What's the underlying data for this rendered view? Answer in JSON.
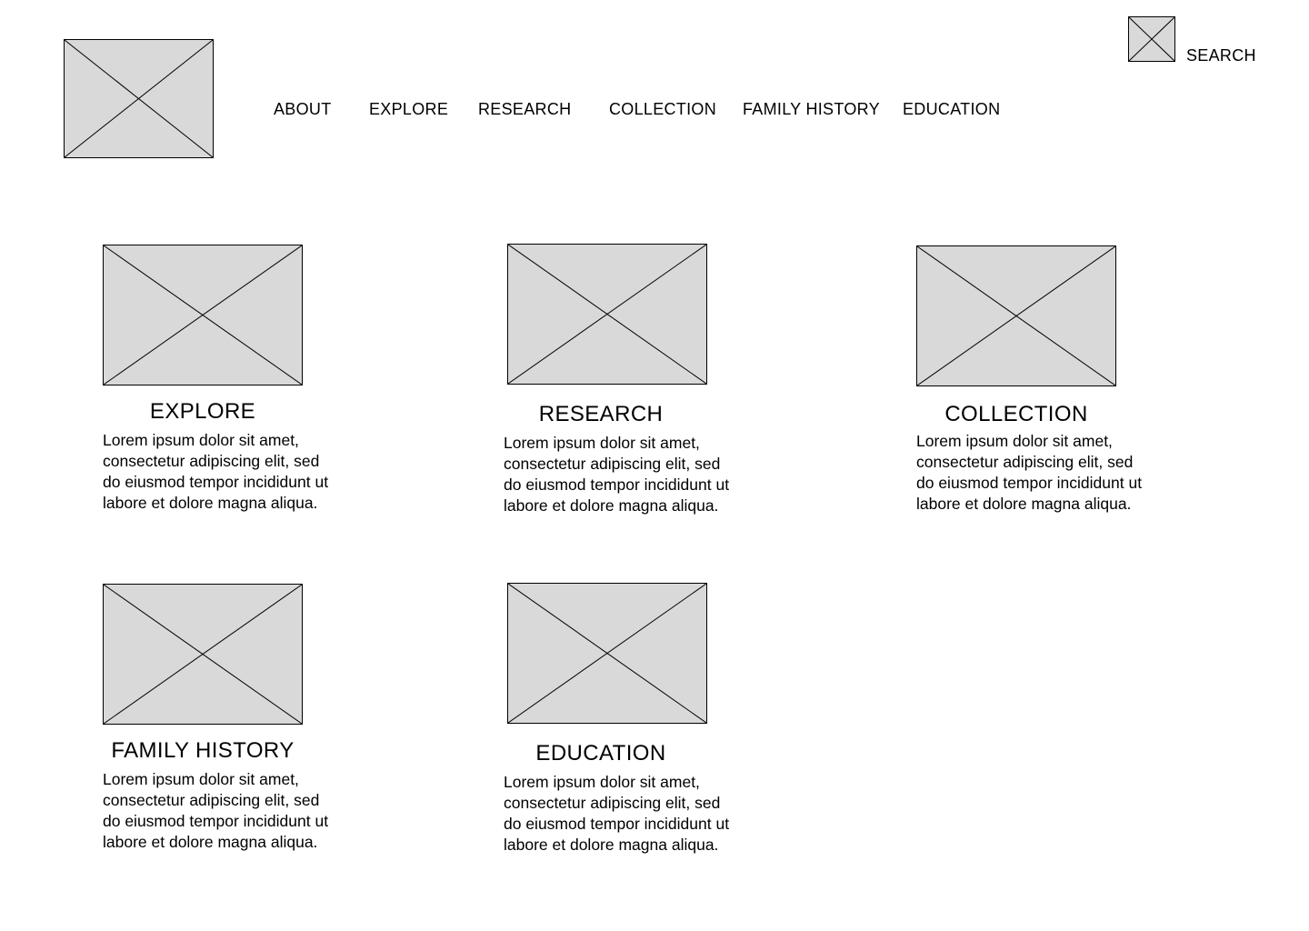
{
  "header": {
    "logo_icon": "image-placeholder-icon",
    "search_icon": "image-placeholder-icon",
    "search_label": "SEARCH"
  },
  "nav": {
    "items": [
      {
        "label": "ABOUT"
      },
      {
        "label": "EXPLORE"
      },
      {
        "label": "RESEARCH"
      },
      {
        "label": "COLLECTION"
      },
      {
        "label": "FAMILY HISTORY"
      },
      {
        "label": "EDUCATION"
      }
    ]
  },
  "cards": [
    {
      "title": "EXPLORE",
      "image_icon": "image-placeholder-icon",
      "description": "Lorem ipsum dolor sit amet, consectetur adipiscing elit, sed do eiusmod tempor incididunt ut labore et dolore magna aliqua."
    },
    {
      "title": "RESEARCH",
      "image_icon": "image-placeholder-icon",
      "description": "Lorem ipsum dolor sit amet, consectetur adipiscing elit, sed do eiusmod tempor incididunt ut labore et dolore magna aliqua."
    },
    {
      "title": "COLLECTION",
      "image_icon": "image-placeholder-icon",
      "description": "Lorem ipsum dolor sit amet, consectetur adipiscing elit, sed do eiusmod tempor incididunt ut labore et dolore magna aliqua."
    },
    {
      "title": "FAMILY HISTORY",
      "image_icon": "image-placeholder-icon",
      "description": "Lorem ipsum dolor sit amet, consectetur adipiscing elit, sed do eiusmod tempor incididunt ut labore et dolore magna aliqua."
    },
    {
      "title": "EDUCATION",
      "image_icon": "image-placeholder-icon",
      "description": "Lorem ipsum dolor sit amet, consectetur adipiscing elit, sed do eiusmod tempor incididunt ut labore et dolore magna aliqua."
    }
  ],
  "colors": {
    "placeholder_fill": "#d9d9d9",
    "stroke": "#000000",
    "background": "#ffffff"
  }
}
